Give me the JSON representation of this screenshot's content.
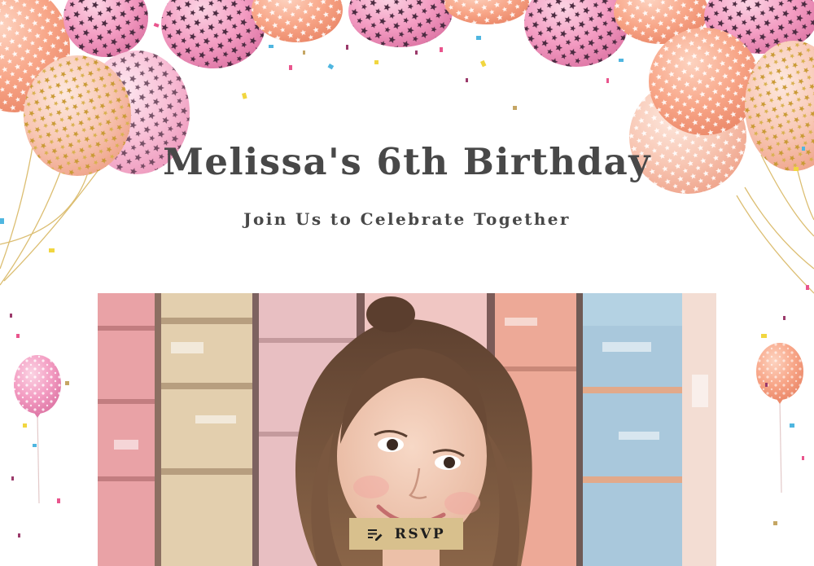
{
  "invitation": {
    "title": "Melissa's 6th Birthday",
    "subtitle": "Join Us to Celebrate Together",
    "rsvp_label": "RSVP",
    "rsvp_icon": "edit-list-icon"
  },
  "decorations": {
    "balloon_icon": "balloon-icon",
    "confetti_icon": "confetti-icon",
    "photo": "girl-portrait-photo"
  },
  "colors": {
    "title_text": "#484848",
    "rsvp_background": "#d8c08d",
    "balloon_pink": "#f09bbf",
    "balloon_peach": "#f7a586",
    "balloon_gold": "#d5ad4f"
  }
}
